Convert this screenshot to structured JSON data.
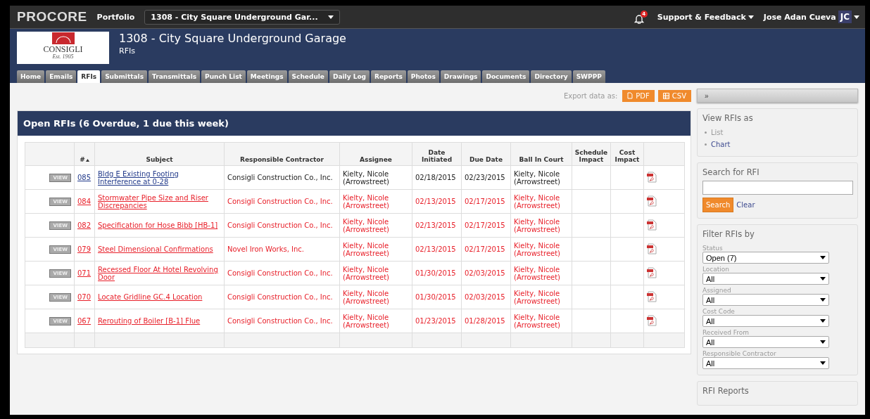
{
  "topbar": {
    "logo": "PROCORE",
    "portfolio": "Portfolio",
    "project_select": "1308 - City Square Underground Gar...",
    "notification_count": "4",
    "support": "Support & Feedback",
    "user": "Jose Adan Cueva",
    "initials": "JC"
  },
  "header": {
    "company_logo": {
      "name": "CONSIGLI",
      "established": "Est. 1905"
    },
    "title": "1308 - City Square Underground Garage",
    "subtitle": "RFIs"
  },
  "tabs": [
    {
      "label": "Home",
      "selected": false
    },
    {
      "label": "Emails",
      "selected": false
    },
    {
      "label": "RFIs",
      "selected": true
    },
    {
      "label": "Submittals",
      "selected": false
    },
    {
      "label": "Transmittals",
      "selected": false
    },
    {
      "label": "Punch List",
      "selected": false
    },
    {
      "label": "Meetings",
      "selected": false
    },
    {
      "label": "Schedule",
      "selected": false
    },
    {
      "label": "Daily Log",
      "selected": false
    },
    {
      "label": "Reports",
      "selected": false
    },
    {
      "label": "Photos",
      "selected": false
    },
    {
      "label": "Drawings",
      "selected": false
    },
    {
      "label": "Documents",
      "selected": false
    },
    {
      "label": "Directory",
      "selected": false
    },
    {
      "label": "SWPPP",
      "selected": false
    }
  ],
  "export": {
    "label": "Export data as:",
    "buttons": [
      "PDF",
      "CSV"
    ]
  },
  "panel": {
    "title": "Open RFIs (6 Overdue, 1 due this week)"
  },
  "table": {
    "columns": [
      "#",
      "Subject",
      "Responsible Contractor",
      "Assignee",
      "Date Initiated",
      "Due Date",
      "Ball In Court",
      "Schedule Impact",
      "Cost Impact"
    ],
    "rows": [
      {
        "view": "VIEW",
        "number": "085",
        "subject": "Bldg E Existing Footing Interference at 0-28",
        "contractor": "Consigli Construction Co., Inc.",
        "assignee": "Kielty, Nicole (Arrowstreet)",
        "initiated": "02/18/2015",
        "due": "02/23/2015",
        "ball_in_court": "Kielty, Nicole (Arrowstreet)",
        "overdue": false
      },
      {
        "view": "VIEW",
        "number": "084",
        "subject": "Stormwater Pipe Size and Riser Discrepancies",
        "contractor": "Consigli Construction Co., Inc.",
        "assignee": "Kielty, Nicole (Arrowstreet)",
        "initiated": "02/13/2015",
        "due": "02/17/2015",
        "ball_in_court": "Kielty, Nicole (Arrowstreet)",
        "overdue": true
      },
      {
        "view": "VIEW",
        "number": "082",
        "subject": "Specification for Hose Bibb [HB-1]",
        "contractor": "Consigli Construction Co., Inc.",
        "assignee": "Kielty, Nicole (Arrowstreet)",
        "initiated": "02/13/2015",
        "due": "02/17/2015",
        "ball_in_court": "Kielty, Nicole (Arrowstreet)",
        "overdue": true
      },
      {
        "view": "VIEW",
        "number": "079",
        "subject": "Steel Dimensional Confirmations",
        "contractor": "Novel Iron Works, Inc.",
        "assignee": "Kielty, Nicole (Arrowstreet)",
        "initiated": "02/13/2015",
        "due": "02/17/2015",
        "ball_in_court": "Kielty, Nicole (Arrowstreet)",
        "overdue": true
      },
      {
        "view": "VIEW",
        "number": "071",
        "subject": "Recessed Floor At Hotel Revolving Door",
        "contractor": "Consigli Construction Co., Inc.",
        "assignee": "Kielty, Nicole (Arrowstreet)",
        "initiated": "01/30/2015",
        "due": "02/03/2015",
        "ball_in_court": "Kielty, Nicole (Arrowstreet)",
        "overdue": true
      },
      {
        "view": "VIEW",
        "number": "070",
        "subject": "Locate Gridline GC.4 Location",
        "contractor": "Consigli Construction Co., Inc.",
        "assignee": "Kielty, Nicole (Arrowstreet)",
        "initiated": "01/30/2015",
        "due": "02/03/2015",
        "ball_in_court": "Kielty, Nicole (Arrowstreet)",
        "overdue": true
      },
      {
        "view": "VIEW",
        "number": "067",
        "subject": "Rerouting of Boiler [B-1] Flue",
        "contractor": "Consigli Construction Co., Inc.",
        "assignee": "Kielty, Nicole (Arrowstreet)",
        "initiated": "01/23/2015",
        "due": "01/28/2015",
        "ball_in_court": "Kielty, Nicole (Arrowstreet)",
        "overdue": true
      }
    ]
  },
  "sidebar": {
    "toggle": "»",
    "view_as": {
      "title": "View RFIs as",
      "items": [
        {
          "label": "List",
          "selected": true
        },
        {
          "label": "Chart",
          "selected": false
        }
      ]
    },
    "search": {
      "title": "Search for RFI",
      "button": "Search",
      "clear": "Clear"
    },
    "filter": {
      "title": "Filter RFIs by",
      "fields": [
        {
          "label": "Status",
          "value": "Open (7)"
        },
        {
          "label": "Location",
          "value": "All"
        },
        {
          "label": "Assigned",
          "value": "All"
        },
        {
          "label": "Cost Code",
          "value": "All"
        },
        {
          "label": "Received From",
          "value": "All"
        },
        {
          "label": "Responsible Contractor",
          "value": "All"
        }
      ]
    },
    "reports": {
      "title": "RFI Reports"
    }
  }
}
